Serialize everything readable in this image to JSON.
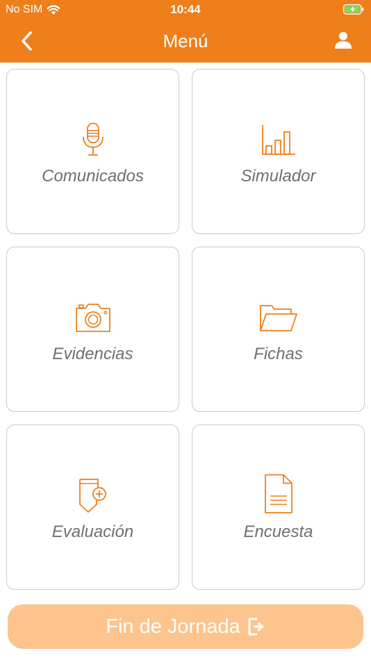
{
  "status": {
    "carrier": "No SIM",
    "time": "10:44"
  },
  "nav": {
    "title": "Menú"
  },
  "menu": [
    {
      "label": "Comunicados",
      "icon": "microphone-icon"
    },
    {
      "label": "Simulador",
      "icon": "bar-chart-icon"
    },
    {
      "label": "Evidencias",
      "icon": "camera-icon"
    },
    {
      "label": "Fichas",
      "icon": "folder-icon"
    },
    {
      "label": "Evaluación",
      "icon": "document-badge-plus-icon"
    },
    {
      "label": "Encuesta",
      "icon": "document-icon"
    }
  ],
  "footer": {
    "button_label": "Fin de Jornada",
    "icon": "logout-icon"
  },
  "colors": {
    "brand": "#EE7F1B",
    "button_disabled": "#FDC48E",
    "card_text": "#6F6F6F",
    "card_border": "#C9C9C9"
  }
}
